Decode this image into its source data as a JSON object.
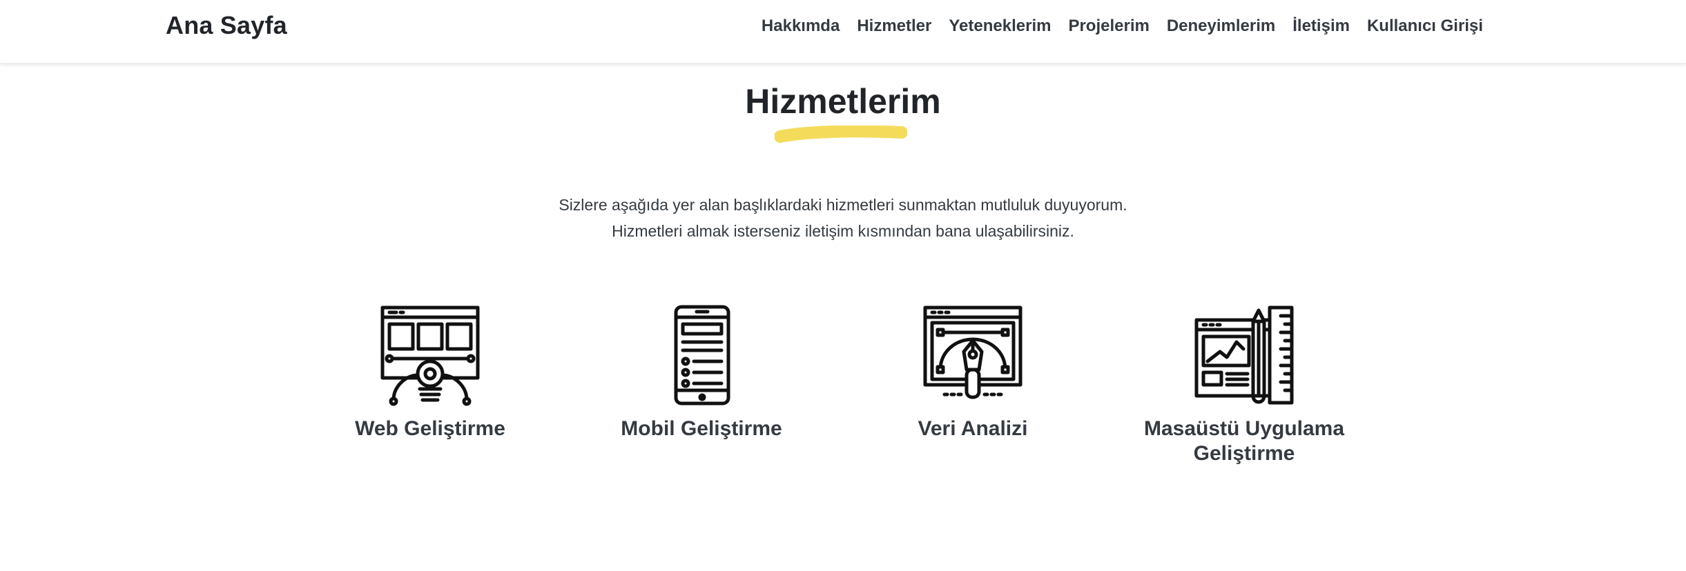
{
  "navbar": {
    "brand": "Ana Sayfa",
    "links": [
      "Hakkımda",
      "Hizmetler",
      "Yeteneklerim",
      "Projelerim",
      "Deneyimlerim",
      "İletişim",
      "Kullanıcı Girişi"
    ]
  },
  "section": {
    "title": "Hizmetlerim",
    "accent_color": "#f4dc5a",
    "lead_line1": "Sizlere aşağıda yer alan başlıklardaki hizmetleri sunmaktan mutluluk duyuyorum.",
    "lead_line2": "Hizmetleri almak isterseniz iletişim kısmından bana ulaşabilirsiniz."
  },
  "services": [
    {
      "title": "Web Geliştirme",
      "icon": "web-design-icon"
    },
    {
      "title": "Mobil Geliştirme",
      "icon": "mobile-app-icon"
    },
    {
      "title": "Veri Analizi",
      "icon": "vector-pen-icon"
    },
    {
      "title_line1": "Masaüstü Uygulama",
      "title_line2": "Geliştirme",
      "icon": "desktop-design-tools-icon"
    }
  ]
}
